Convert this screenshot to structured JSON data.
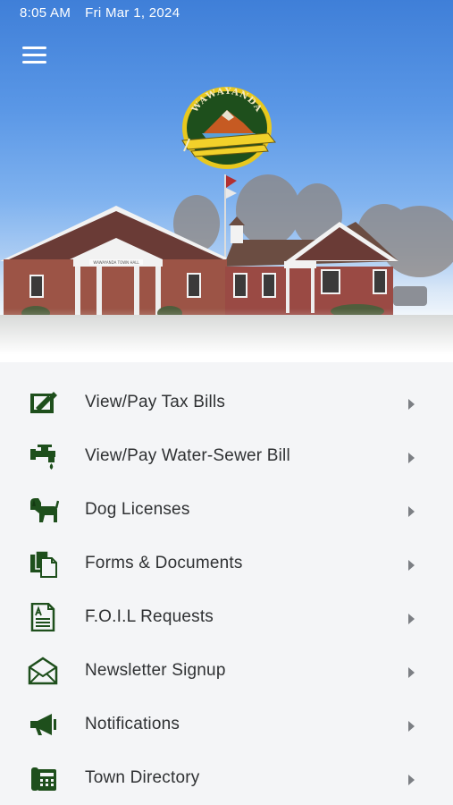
{
  "status_bar": {
    "time": "8:05 AM",
    "date": "Fri Mar 1, 2024"
  },
  "header": {
    "menu_icon": "hamburger-menu-icon",
    "logo_text": "WAWAYANDA",
    "sign_text": "WAWAYANDA TOWN HALL"
  },
  "colors": {
    "brand_green": "#1e4f1c",
    "text": "#2f3133",
    "chevron": "#7c7f84",
    "list_bg": "#f4f5f7"
  },
  "menu": [
    {
      "label": "View/Pay Tax Bills",
      "icon": "tax-bill-icon"
    },
    {
      "label": "View/Pay Water-Sewer Bill",
      "icon": "faucet-icon"
    },
    {
      "label": "Dog Licenses",
      "icon": "dog-icon"
    },
    {
      "label": "Forms & Documents",
      "icon": "documents-icon"
    },
    {
      "label": "F.O.I.L Requests",
      "icon": "foil-request-icon"
    },
    {
      "label": "Newsletter Signup",
      "icon": "envelope-icon"
    },
    {
      "label": "Notifications",
      "icon": "megaphone-icon"
    },
    {
      "label": "Town Directory",
      "icon": "phone-directory-icon"
    }
  ]
}
